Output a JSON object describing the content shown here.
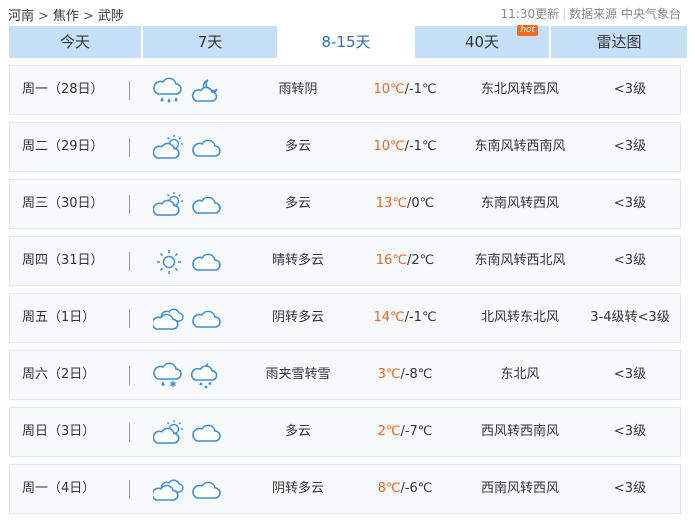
{
  "breadcrumb": {
    "province": "河南",
    "city": "焦作",
    "county": "武陟",
    "separator": ">"
  },
  "meta": {
    "update_time": "11:30更新",
    "source_label": "数据来源",
    "source": "中央气象台",
    "divider": "|"
  },
  "tabs": [
    {
      "label": "今天",
      "active": false
    },
    {
      "label": "7天",
      "active": false
    },
    {
      "label": "8-15天",
      "active": true
    },
    {
      "label": "40天",
      "active": false,
      "badge": "hot"
    },
    {
      "label": "雷达图",
      "active": false
    }
  ],
  "forecast": [
    {
      "day": "周一（28日）",
      "icon1": "cloud-rain-icon",
      "icon2": "moon-cloud-icon",
      "condition": "雨转阴",
      "high": "10℃",
      "low": "-1℃",
      "wind": "东北风转西风",
      "level": "<3级"
    },
    {
      "day": "周二（29日）",
      "icon1": "sun-cloud-icon",
      "icon2": "cloud-icon",
      "condition": "多云",
      "high": "10℃",
      "low": "-1℃",
      "wind": "东南风转西南风",
      "level": "<3级"
    },
    {
      "day": "周三（30日）",
      "icon1": "sun-cloud-icon",
      "icon2": "cloud-icon",
      "condition": "多云",
      "high": "13℃",
      "low": "0℃",
      "wind": "东南风转西风",
      "level": "<3级"
    },
    {
      "day": "周四（31日）",
      "icon1": "sun-icon",
      "icon2": "cloud-icon",
      "condition": "晴转多云",
      "high": "16℃",
      "low": "2℃",
      "wind": "东南风转西北风",
      "level": "<3级"
    },
    {
      "day": "周五（1日）",
      "icon1": "overcast-icon",
      "icon2": "cloud-icon",
      "condition": "阴转多云",
      "high": "14℃",
      "low": "-1℃",
      "wind": "北风转东北风",
      "level": "3-4级转<3级"
    },
    {
      "day": "周六（2日）",
      "icon1": "sleet-icon",
      "icon2": "cloud-snow-icon",
      "condition": "雨夹雪转雪",
      "high": "3℃",
      "low": "-8℃",
      "wind": "东北风",
      "level": "<3级"
    },
    {
      "day": "周日（3日）",
      "icon1": "sun-cloud-icon",
      "icon2": "cloud-icon",
      "condition": "多云",
      "high": "2℃",
      "low": "-7℃",
      "wind": "西风转西南风",
      "level": "<3级"
    },
    {
      "day": "周一（4日）",
      "icon1": "overcast-icon",
      "icon2": "cloud-icon",
      "condition": "阴转多云",
      "high": "8℃",
      "low": "-6℃",
      "wind": "西南风转西风",
      "level": "<3级"
    }
  ]
}
